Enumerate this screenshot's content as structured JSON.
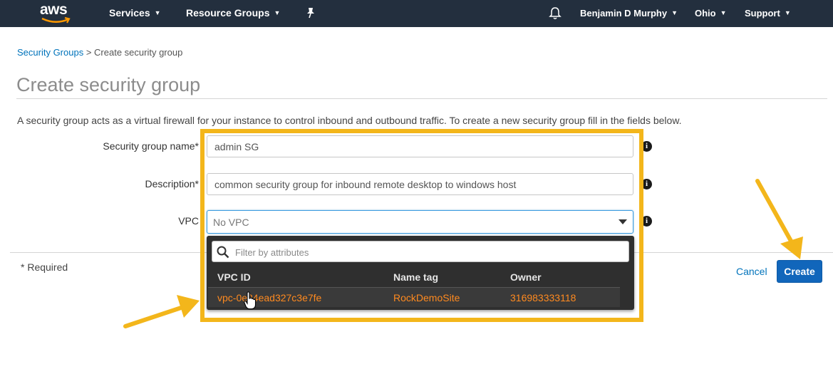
{
  "nav": {
    "logo": "aws",
    "services": "Services",
    "resource_groups": "Resource Groups",
    "user": "Benjamin D Murphy",
    "region": "Ohio",
    "support": "Support"
  },
  "breadcrumb": {
    "parent": "Security Groups",
    "separator": ">",
    "current": "Create security group"
  },
  "page": {
    "title": "Create security group",
    "intro": "A security group acts as a virtual firewall for your instance to control inbound and outbound traffic. To create a new security group fill in the fields below."
  },
  "form": {
    "name_label": "Security group name*",
    "name_value": "admin SG",
    "description_label": "Description*",
    "description_value": "common security group for inbound remote desktop to windows host",
    "vpc_label": "VPC",
    "vpc_value": "No VPC"
  },
  "dropdown": {
    "filter_placeholder": "Filter by attributes",
    "columns": [
      "VPC ID",
      "Name tag",
      "Owner"
    ],
    "rows": [
      {
        "vpc_id": "vpc-0e84ead327c3e7fe",
        "name_tag": "RockDemoSite",
        "owner": "316983333118"
      }
    ]
  },
  "footer": {
    "required_note": "* Required",
    "cancel": "Cancel",
    "create": "Create"
  },
  "colors": {
    "nav_bg": "#232f3e",
    "link": "#0073bb",
    "primary_button": "#1166bb",
    "highlight": "#f3b61b",
    "dropdown_bg": "#2f2f2f",
    "dropdown_text": "#ff8a1f"
  },
  "icons": [
    "bell-icon",
    "pin-icon",
    "info-icon",
    "search-icon",
    "hand-cursor-icon",
    "arrow-icon"
  ]
}
